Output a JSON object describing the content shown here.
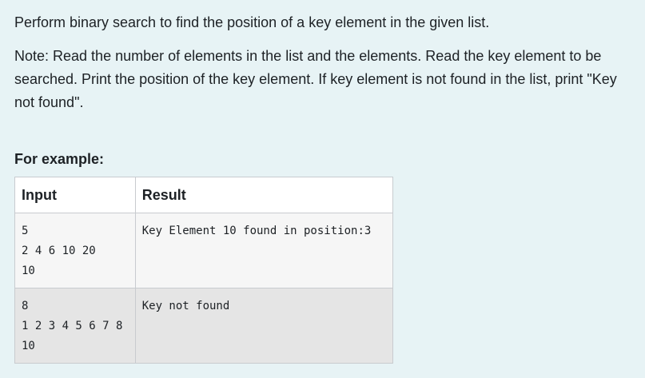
{
  "question": {
    "statement": "Perform binary search to find the position of a key element in the given list.",
    "note": "Note: Read the number of elements in the list and the elements. Read the key element to be searched. Print the position of the key element. If key element is not found in the list, print \"Key not found\"."
  },
  "examples": {
    "heading": "For example:",
    "headers": {
      "input": "Input",
      "result": "Result"
    },
    "rows": [
      {
        "input_lines": [
          "5",
          "2 4 6 10 20",
          "10"
        ],
        "result": "Key Element 10 found in position:3"
      },
      {
        "input_lines": [
          "8",
          "1 2 3 4 5 6 7 8",
          "10"
        ],
        "result": "Key not found"
      }
    ]
  }
}
